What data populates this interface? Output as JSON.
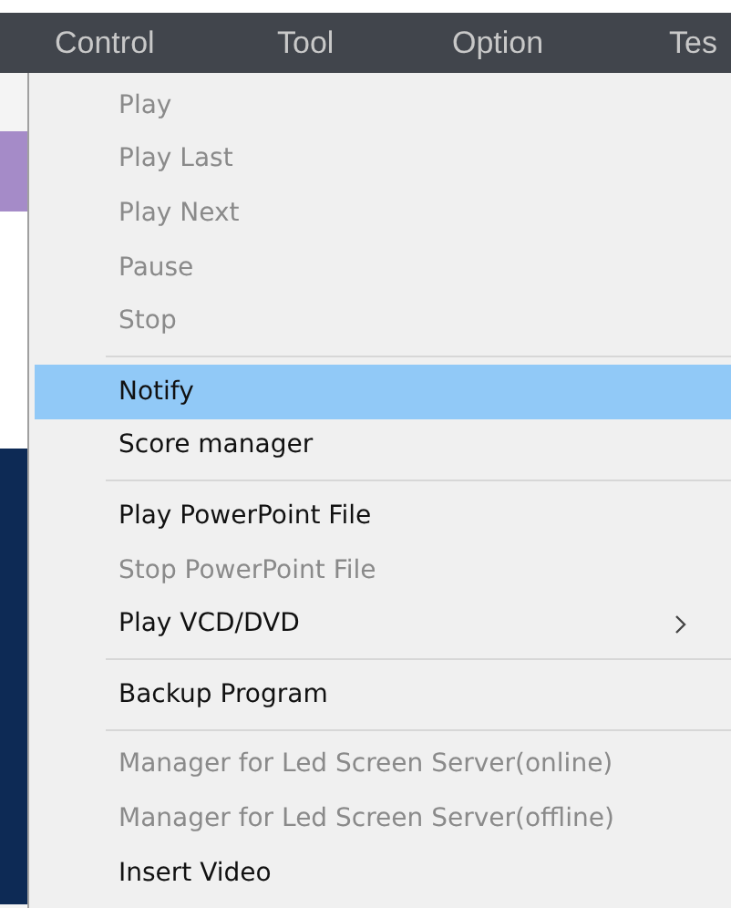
{
  "menubar": [
    {
      "label": "Control"
    },
    {
      "label": "Tool"
    },
    {
      "label": "Option"
    },
    {
      "label": "Tes"
    }
  ],
  "menu": [
    {
      "kind": "item",
      "label": "Play",
      "disabled": true,
      "selected": false
    },
    {
      "kind": "item",
      "label": "Play Last",
      "disabled": true,
      "selected": false
    },
    {
      "kind": "item",
      "label": "Play Next",
      "disabled": true,
      "selected": false
    },
    {
      "kind": "item",
      "label": "Pause",
      "disabled": true,
      "selected": false
    },
    {
      "kind": "item",
      "label": "Stop",
      "disabled": true,
      "selected": false
    },
    {
      "kind": "separator"
    },
    {
      "kind": "item",
      "label": "Notify",
      "disabled": false,
      "selected": true
    },
    {
      "kind": "item",
      "label": "Score manager",
      "disabled": false,
      "selected": false
    },
    {
      "kind": "separator"
    },
    {
      "kind": "item",
      "label": "Play PowerPoint File",
      "disabled": false,
      "selected": false
    },
    {
      "kind": "item",
      "label": "Stop PowerPoint File",
      "disabled": true,
      "selected": false
    },
    {
      "kind": "submenu",
      "label": "Play VCD/DVD",
      "disabled": false,
      "selected": false
    },
    {
      "kind": "separator"
    },
    {
      "kind": "item",
      "label": "Backup Program",
      "disabled": false,
      "selected": false
    },
    {
      "kind": "separator"
    },
    {
      "kind": "item",
      "label": "Manager for Led Screen Server(online)",
      "disabled": true,
      "selected": false
    },
    {
      "kind": "item",
      "label": "Manager for Led Screen Server(offline)",
      "disabled": true,
      "selected": false
    },
    {
      "kind": "item",
      "label": "Insert Video",
      "disabled": false,
      "selected": false
    }
  ]
}
